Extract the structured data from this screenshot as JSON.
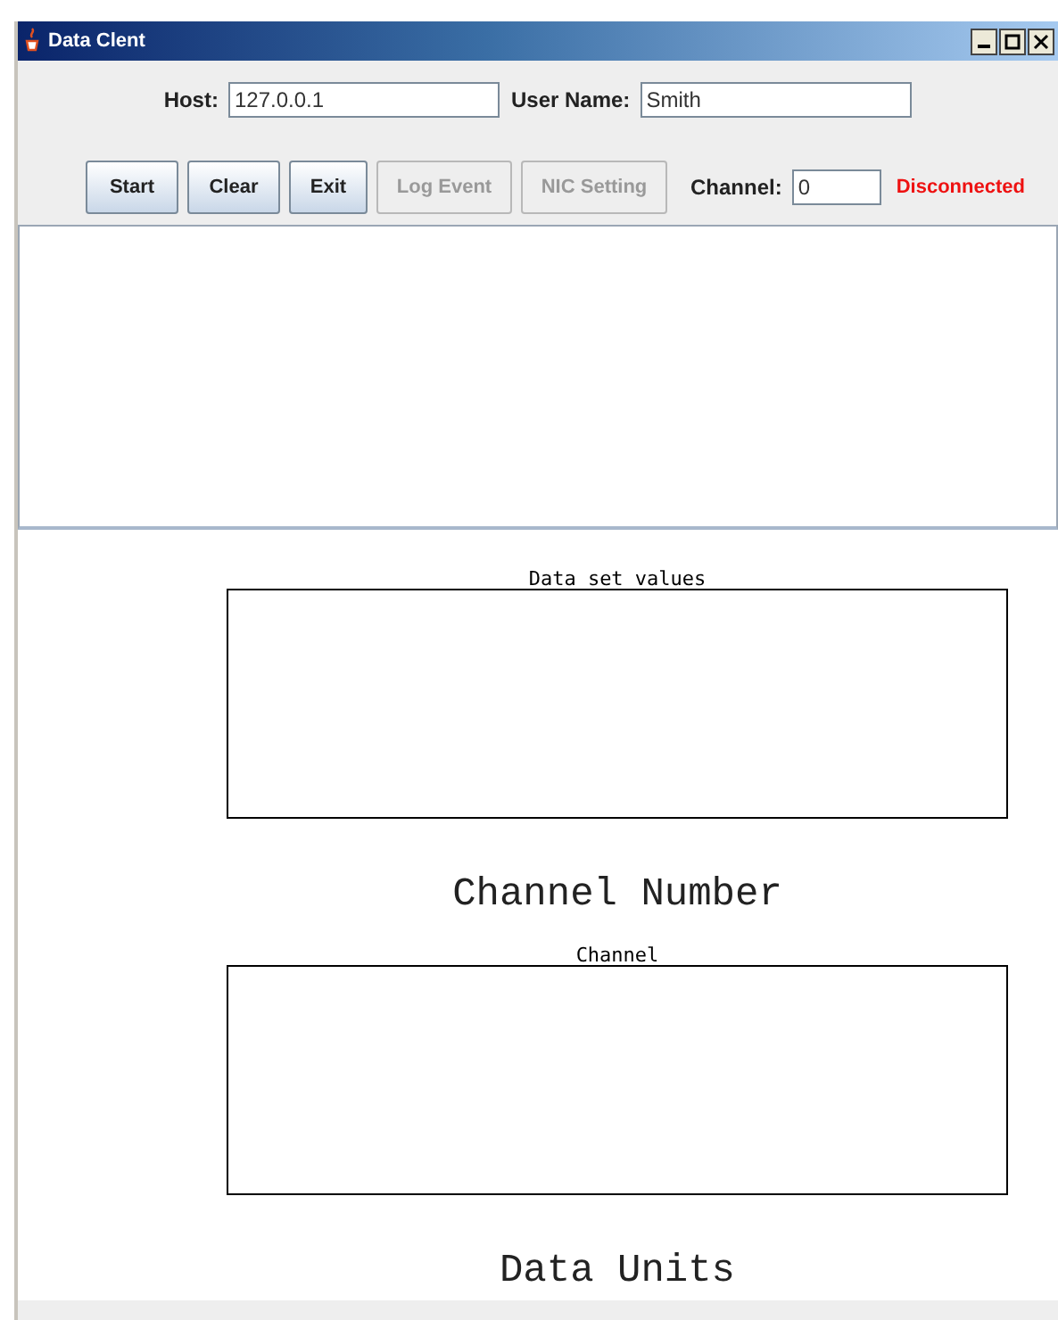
{
  "window": {
    "title": "Data Clent"
  },
  "connection": {
    "host_label": "Host:",
    "host": "127.0.0.1",
    "user_label": "User Name:",
    "user": "Smith"
  },
  "buttons": [
    {
      "label": "Start",
      "disabled": false
    },
    {
      "label": "Clear",
      "disabled": false
    },
    {
      "label": "Exit",
      "disabled": false
    },
    {
      "label": "Log Event",
      "disabled": true
    },
    {
      "label": "NIC Setting",
      "disabled": true
    }
  ],
  "channel": {
    "label": "Channel:",
    "value": "0"
  },
  "status": {
    "text": "Disconnected",
    "connected": false
  },
  "plots": [
    {
      "title": "Data set values",
      "xlabel": "Channel Number"
    },
    {
      "title": "Channel",
      "xlabel": "Data Units"
    }
  ]
}
